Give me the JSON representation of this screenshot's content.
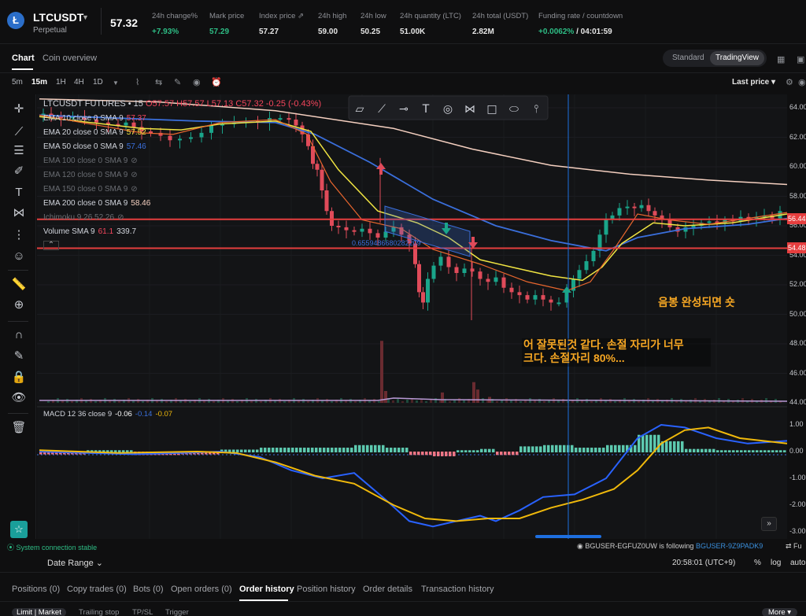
{
  "header": {
    "symbol": "LTCUSDT",
    "type": "Perpetual",
    "last_price": "57.32",
    "stats": [
      {
        "label": "24h change%",
        "value": "+7.93%",
        "tone": "green"
      },
      {
        "label": "Mark price",
        "value": "57.29",
        "tone": "green"
      },
      {
        "label": "Index price",
        "value": "57.27",
        "tone": "white"
      },
      {
        "label": "24h high",
        "value": "59.00",
        "tone": "white"
      },
      {
        "label": "24h low",
        "value": "50.25",
        "tone": "white"
      },
      {
        "label": "24h quantity (LTC)",
        "value": "51.00K",
        "tone": "white"
      },
      {
        "label": "24h total (USDT)",
        "value": "2.82M",
        "tone": "white"
      }
    ],
    "funding_label": "Funding rate / countdown",
    "funding_rate": "+0.0062%",
    "countdown": "/ 04:01:59"
  },
  "tabs": {
    "chart": "Chart",
    "overview": "Coin overview"
  },
  "view_switch": {
    "standard": "Standard",
    "tradingview": "TradingView"
  },
  "toolbar": {
    "timeframes": [
      "5m",
      "15m",
      "1H",
      "4H",
      "1D"
    ],
    "active_timeframe": "15m",
    "last_price_label": "Last price"
  },
  "legend": {
    "title": "LTCUSDT FUTURES • 15",
    "ohlc": "O57.57 H57.57 L57.13 C57.32 -0.25 (-0.43%)",
    "emas": [
      {
        "label": "EMA 10 close 0 SMA 9",
        "value": "57.37",
        "color": "#f6465d",
        "dim": false
      },
      {
        "label": "EMA 20 close 0 SMA 9",
        "value": "57.52",
        "color": "#f0e442",
        "dim": false
      },
      {
        "label": "EMA 50 close 0 SMA 9",
        "value": "57.46",
        "color": "#3a6fdc",
        "dim": false
      },
      {
        "label": "EMA 100 close 0 SMA 9",
        "value": "",
        "color": "",
        "dim": true
      },
      {
        "label": "EMA 120 close 0 SMA 9",
        "value": "",
        "color": "",
        "dim": true
      },
      {
        "label": "EMA 150 close 0 SMA 9",
        "value": "",
        "color": "",
        "dim": true
      },
      {
        "label": "EMA 200 close 0 SMA 9",
        "value": "58.46",
        "color": "#f5d0c0",
        "dim": false
      },
      {
        "label": "Ichimoku 9 26 52 26",
        "value": "",
        "color": "",
        "dim": true
      }
    ],
    "volume": {
      "label": "Volume SMA 9",
      "v1": "61.1",
      "v2": "339.7"
    },
    "macd": {
      "label": "MACD 12 36 close 9",
      "v1": "-0.06",
      "v2": "-0.14",
      "v3": "-0.07"
    }
  },
  "fib_label": "0.6559486680282209",
  "price_axis": [
    "64.00",
    "62.00",
    "60.00",
    "58.00",
    "56.00",
    "54.00",
    "52.00",
    "50.00",
    "48.00",
    "46.00",
    "44.00"
  ],
  "macd_axis": [
    "1.00",
    "0.00",
    "-1.00",
    "-2.00",
    "-3.00"
  ],
  "price_tags": [
    {
      "value": "56.44",
      "color": "#e53e3e"
    },
    {
      "value": "54.48",
      "color": "#e53e3e"
    }
  ],
  "annotations": {
    "note1": "음봉 완성되면 숏",
    "note2_line1": "어 잘못된것 같다. 손절 자리가 너무",
    "note2_line2": "크다. 손절자리 80%..."
  },
  "status": {
    "connection": "System connection stable",
    "date_range": "Date Range",
    "follow_user": "BGUSER-EGFUZ0UW",
    "follow_text": "is following",
    "follow_target": "BGUSER-9Z9PADK9",
    "time": "20:58:01 (UTC+9)",
    "pct": "%",
    "log": "log",
    "auto": "auto",
    "fu": "Fu"
  },
  "order_tabs": [
    "Positions (0)",
    "Copy trades (0)",
    "Bots (0)",
    "Open orders (0)",
    "Order history",
    "Position history",
    "Order details",
    "Transaction history"
  ],
  "active_order_tab": "Order history",
  "sub_tabs": [
    "Limit | Market",
    "Trailing stop",
    "TP/SL",
    "Trigger"
  ],
  "more": "More"
}
